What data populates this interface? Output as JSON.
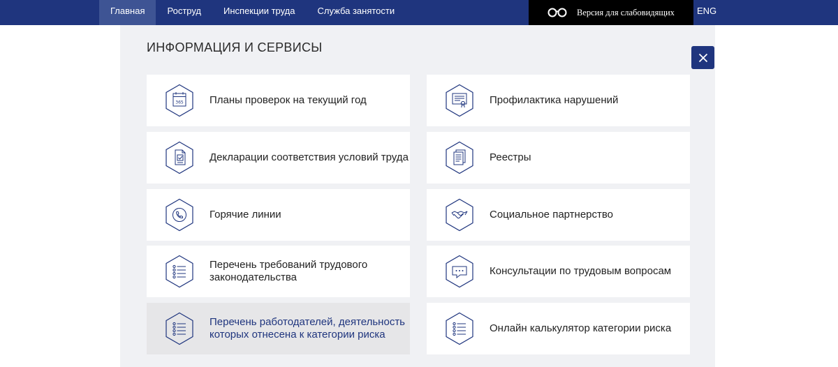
{
  "header": {
    "nav": [
      {
        "label": "Главная",
        "active": true
      },
      {
        "label": "Роструд",
        "active": false
      },
      {
        "label": "Инспекции труда",
        "active": false
      },
      {
        "label": "Служба занятости",
        "active": false
      }
    ],
    "vision_label": "Версия для слабовидящих",
    "lang_label": "ENG"
  },
  "panel": {
    "title": "ИНФОРМАЦИЯ И СЕРВИСЫ",
    "cards": [
      {
        "label": "Планы проверок на текущий год",
        "icon": "calendar-icon",
        "calendar_text": "365"
      },
      {
        "label": "Профилактика нарушений",
        "icon": "certificate-icon"
      },
      {
        "label": "Декларации соответствия условий труда",
        "icon": "document-check-icon"
      },
      {
        "label": "Реестры",
        "icon": "documents-icon"
      },
      {
        "label": "Горячие линии",
        "icon": "phone-icon"
      },
      {
        "label": "Социальное партнерство",
        "icon": "handshake-icon"
      },
      {
        "label": "Перечень требований трудового законодательства",
        "icon": "list-icon"
      },
      {
        "label": "Консультации по трудовым вопросам",
        "icon": "chat-icon"
      },
      {
        "label": "Перечень работодателей, деятельность которых отнесена к категории риска",
        "icon": "list-icon",
        "highlighted": true
      },
      {
        "label": "Онлайн калькулятор категории риска",
        "icon": "list-icon"
      }
    ]
  },
  "colors": {
    "brand": "#1f357e",
    "nav_active": "#3e5494",
    "panel_bg": "#f0f1f4",
    "card_bg": "#ffffff",
    "card_highlight": "#e6e6e8"
  }
}
